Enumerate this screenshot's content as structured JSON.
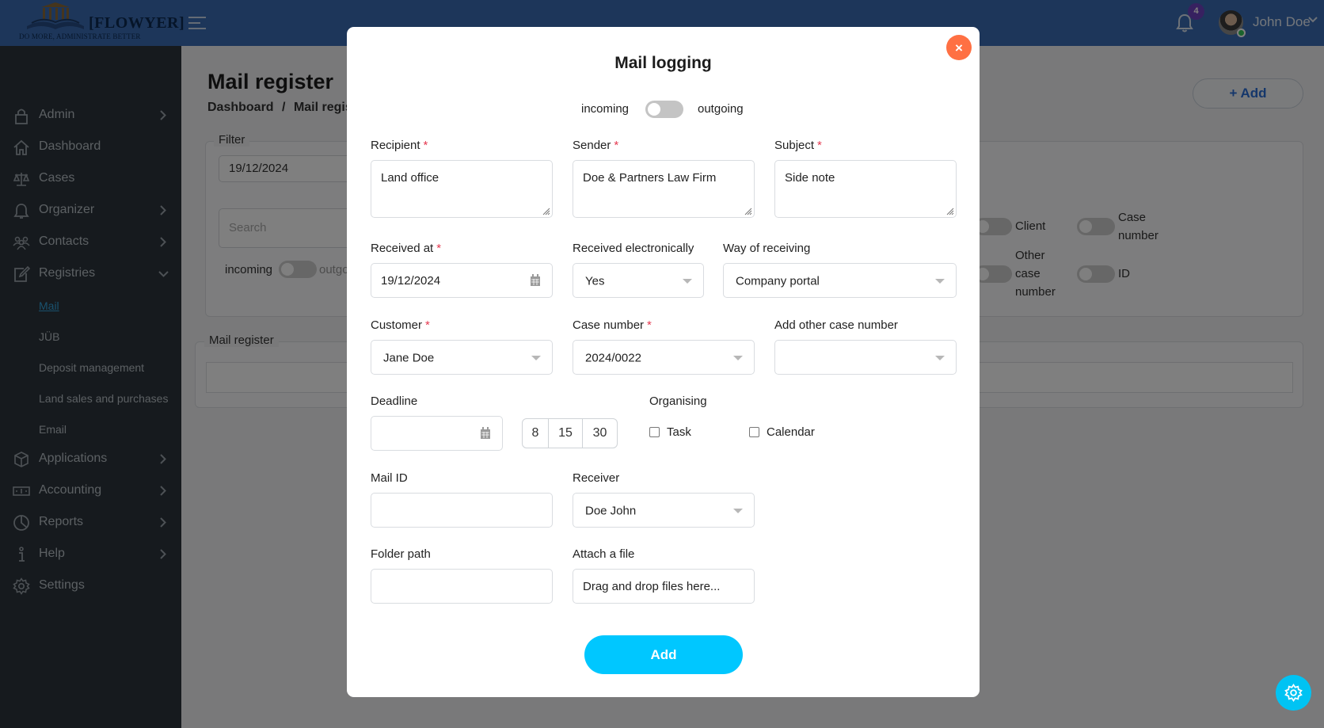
{
  "header": {
    "logo_brand": "[FLOWYER]",
    "logo_tagline": "DO MORE, ADMINISTRATE BETTER",
    "notification_count": "4",
    "user_name": "John Doe"
  },
  "sidebar": {
    "items": [
      {
        "label": "Admin",
        "icon": "lock-icon",
        "has_children": true
      },
      {
        "label": "Dashboard",
        "icon": "home-icon",
        "has_children": false
      },
      {
        "label": "Cases",
        "icon": "scales-icon",
        "has_children": false
      },
      {
        "label": "Organizer",
        "icon": "bell-icon",
        "has_children": true
      },
      {
        "label": "Contacts",
        "icon": "people-icon",
        "has_children": true
      },
      {
        "label": "Registries",
        "icon": "edit-icon",
        "has_children": true,
        "expanded": true
      },
      {
        "label": "Applications",
        "icon": "box-icon",
        "has_children": true
      },
      {
        "label": "Accounting",
        "icon": "money-icon",
        "has_children": true
      },
      {
        "label": "Reports",
        "icon": "pie-chart-icon",
        "has_children": true
      },
      {
        "label": "Help",
        "icon": "info-icon",
        "has_children": true
      },
      {
        "label": "Settings",
        "icon": "gear-icon",
        "has_children": false
      }
    ],
    "registries_sub": [
      {
        "label": "Mail",
        "active": true
      },
      {
        "label": "JÜB",
        "active": false
      },
      {
        "label": "Deposit management",
        "active": false
      },
      {
        "label": "Land sales and purchases",
        "active": false
      },
      {
        "label": "Email",
        "active": false
      }
    ]
  },
  "page": {
    "title": "Mail register",
    "breadcrumb": [
      "Dashboard",
      "Mail register"
    ],
    "breadcrumb_separator": "/",
    "add_label": "Add",
    "filter": {
      "legend": "Filter",
      "date": "19/12/2024",
      "search_placeholder": "Search",
      "incoming": "incoming",
      "outgoing": "outgoing",
      "column_toggles": [
        "Client",
        "Case number",
        "Other case number",
        "ID"
      ]
    },
    "register_legend": "Mail register"
  },
  "modal": {
    "title": "Mail logging",
    "direction": {
      "left": "incoming",
      "right": "outgoing",
      "selected": "incoming"
    },
    "fields": {
      "recipient": {
        "label": "Recipient",
        "required": true,
        "value": "Land office"
      },
      "sender": {
        "label": "Sender",
        "required": true,
        "value": "Doe & Partners Law Firm"
      },
      "subject": {
        "label": "Subject",
        "required": true,
        "value": "Side note"
      },
      "received_at": {
        "label": "Received at",
        "required": true,
        "value": "19/12/2024"
      },
      "received_electronically": {
        "label": "Received electronically",
        "value": "Yes"
      },
      "way_of_receiving": {
        "label": "Way of receiving",
        "value": "Company portal"
      },
      "customer": {
        "label": "Customer",
        "required": true,
        "value": "Jane Doe"
      },
      "case_number": {
        "label": "Case number",
        "required": true,
        "value": "2024/0022"
      },
      "other_case_number": {
        "label": "Add other case number",
        "value": ""
      },
      "deadline": {
        "label": "Deadline",
        "value": "",
        "quick_days": [
          "8",
          "15",
          "30"
        ]
      },
      "organising": {
        "label": "Organising",
        "options": [
          {
            "label": "Task",
            "checked": false
          },
          {
            "label": "Calendar",
            "checked": false
          }
        ]
      },
      "mail_id": {
        "label": "Mail ID",
        "value": ""
      },
      "receiver": {
        "label": "Receiver",
        "value": "Doe John"
      },
      "folder_path": {
        "label": "Folder path",
        "value": ""
      },
      "attach_file": {
        "label": "Attach a file",
        "placeholder": "Drag and drop files here..."
      }
    },
    "submit_label": "Add",
    "close_label": "×"
  },
  "colors": {
    "header": "#3a6db5",
    "sidebar": "#2c353c",
    "accent": "#00c7ff",
    "close": "#ff7043",
    "required": "#e53950",
    "badge": "#6f42c1"
  }
}
